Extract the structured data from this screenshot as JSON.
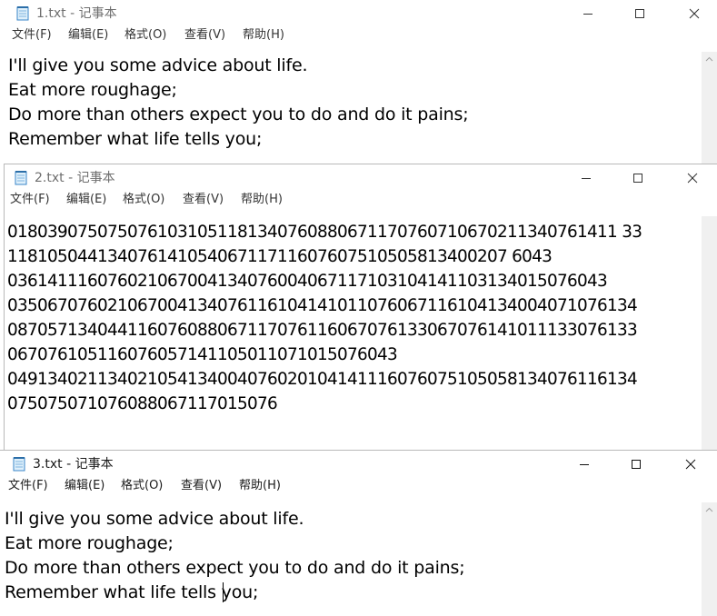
{
  "windows": [
    {
      "title": "1.txt - 记事本",
      "menu": [
        "文件(F)",
        "编辑(E)",
        "格式(O)",
        "查看(V)",
        "帮助(H)"
      ],
      "lines": [
        "I'll give you some advice about life.",
        "Eat more roughage;",
        "Do more than others expect you to do and do it pains;",
        "Remember what life tells you;"
      ]
    },
    {
      "title": "2.txt - 记事本",
      "menu": [
        "文件(F)",
        "编辑(E)",
        "格式(O)",
        "查看(V)",
        "帮助(H)"
      ],
      "lines": [
        "0180390750750761031051181340760880671170760710670211340761411 33",
        "11810504413407614105406711711607607510505813400207 6043",
        "036141116076021067004134076004067117103104141103134015076043",
        "035067076021067004134076116104141011076067116104134004071076134",
        "087057134044116076088067117076116067076133067076141011133076133",
        "067076105116076057141105011071015076043",
        "049134021134021054134004076020104141116076075105058134076116134",
        "075075071076088067117015076"
      ]
    },
    {
      "title": "3.txt - 记事本",
      "menu": [
        "文件(F)",
        "编辑(E)",
        "格式(O)",
        "查看(V)",
        "帮助(H)"
      ],
      "lines": [
        "I'll give you some advice about life.",
        "Eat more roughage;",
        "Do more than others expect you to do and do it pains;",
        "Remember what life tells you;"
      ]
    }
  ]
}
